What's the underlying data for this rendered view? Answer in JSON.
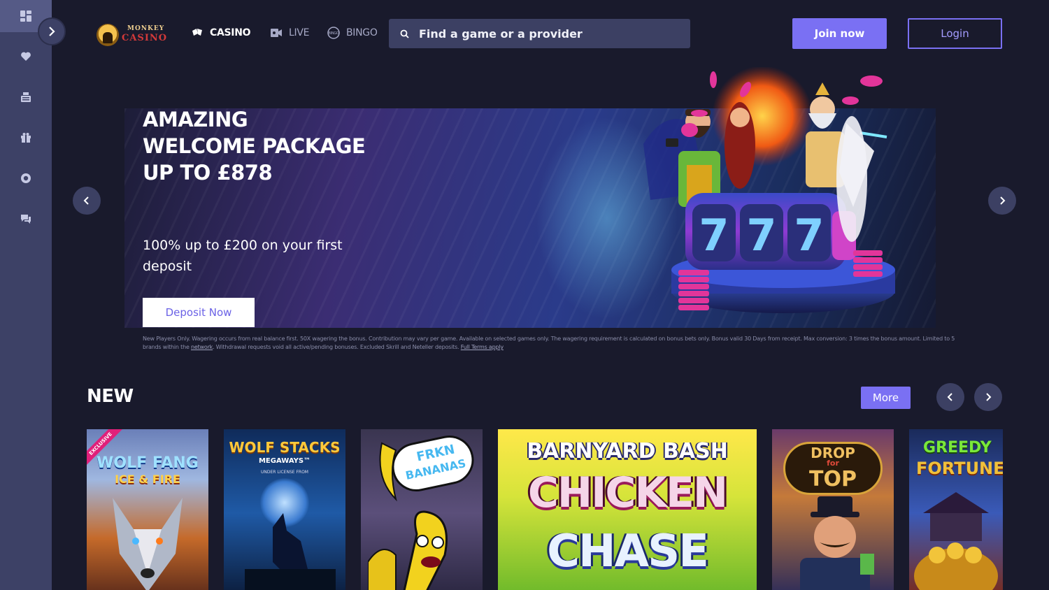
{
  "sidebar": {
    "toggle_icon": "chevron-right-icon",
    "items": [
      {
        "icon": "dashboard-icon",
        "active": true
      },
      {
        "icon": "heart-icon"
      },
      {
        "icon": "cashier-icon"
      },
      {
        "icon": "gift-icon"
      },
      {
        "icon": "lifebuoy-icon"
      },
      {
        "icon": "chat-support-icon"
      }
    ]
  },
  "header": {
    "logo": {
      "line1": "MONKEY",
      "line2": "CASINO"
    },
    "nav": [
      {
        "label": "CASINO",
        "icon": "cards-icon",
        "active": true
      },
      {
        "label": "LIVE",
        "icon": "live-icon"
      },
      {
        "label": "BINGO",
        "icon": "bingo-icon"
      }
    ],
    "search": {
      "placeholder": "Find a game or a provider",
      "value": ""
    },
    "join_label": "Join now",
    "login_label": "Login"
  },
  "hero": {
    "title": "AMAZING WELCOME PACKAGE UP TO £878",
    "subtitle": "100% up to £200 on your first deposit",
    "cta_label": "Deposit Now",
    "terms_text": "New Players Only. Wagering occurs from real balance first. 50X wagering the bonus. Contribution may vary per game. Available on selected games only. The wagering requirement is calculated on bonus bets only. Bonus valid 30 Days from receipt. Max conversion: 3 times the bonus amount. Limited to 5 brands within the",
    "terms_link_network": "network",
    "terms_text2": ". Withdrawal requests void all active/pending bonuses. Excluded Skrill and Neteller deposits.",
    "terms_link_full": "Full Terms apply",
    "slot_digits": "777"
  },
  "section_new": {
    "title": "NEW",
    "more_label": "More",
    "games": [
      {
        "name_line1": "WOLF FANG",
        "name_line2": "ICE & FIRE",
        "badge": "EXCLUSIVE"
      },
      {
        "name_line1": "WOLF STACKS",
        "name_line2": "MEGAWAYS™",
        "note": "UNDER LICENSE FROM"
      },
      {
        "name_line1": "FRKN",
        "name_line2": "BANANAS"
      },
      {
        "name_line1": "BARNYARD BASH",
        "name_line2": "CHICKEN",
        "name_line3": "CHASE"
      },
      {
        "name_line1": "DROP",
        "name_line2": "for",
        "name_line3": "TOP"
      },
      {
        "name_line1": "GREEDY",
        "name_line2": "FORTUNE P"
      }
    ]
  }
}
